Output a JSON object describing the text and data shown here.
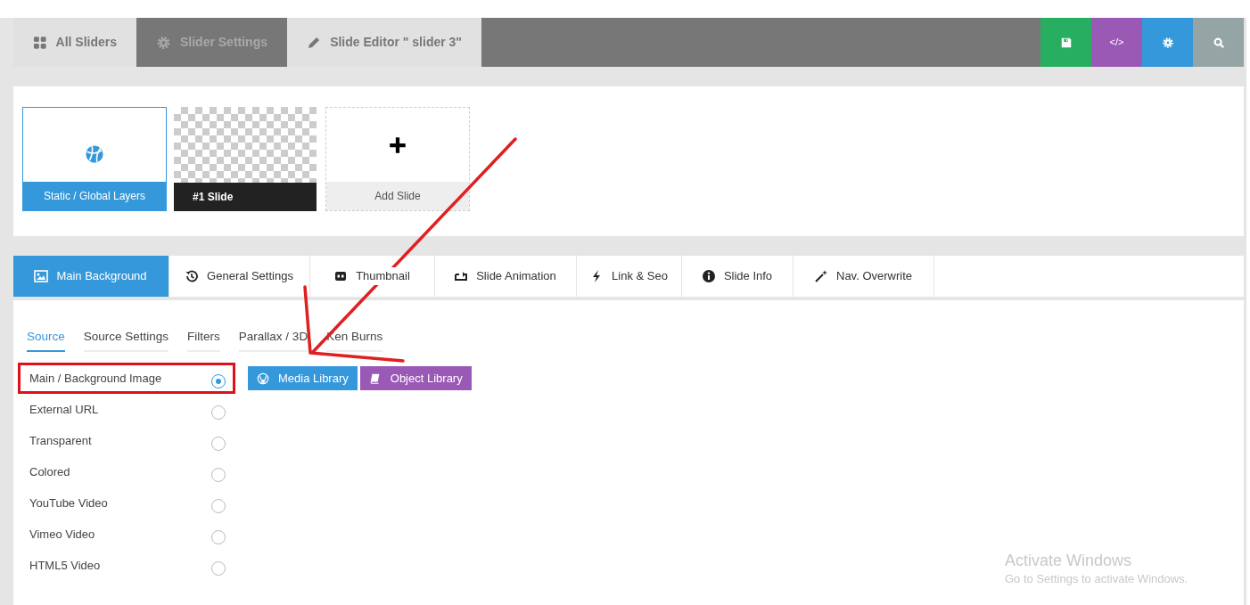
{
  "top_nav": {
    "tabs": [
      {
        "label": "All Sliders",
        "kind": "grid",
        "highlighted": true
      },
      {
        "label": "Slider Settings",
        "kind": "gear",
        "highlighted": false
      },
      {
        "label": "Slide Editor \" slider 3\"",
        "kind": "pencil",
        "highlighted": true
      }
    ],
    "tools": [
      {
        "kind": "save",
        "color": "#27ae60"
      },
      {
        "kind": "code",
        "label": "</>",
        "color": "#9b59b6"
      },
      {
        "kind": "settings",
        "color": "#3498db"
      },
      {
        "kind": "search",
        "color": "#95a5a6"
      }
    ]
  },
  "slides": [
    {
      "kind": "global",
      "label": "Static / Global Layers"
    },
    {
      "kind": "slide",
      "label": "#1 Slide"
    },
    {
      "kind": "add",
      "label": "Add Slide"
    }
  ],
  "editor_tabs": [
    {
      "label": "Main Background",
      "selected": true
    },
    {
      "label": "General Settings",
      "selected": false
    },
    {
      "label": "Thumbnail",
      "selected": false
    },
    {
      "label": "Slide Animation",
      "selected": false
    },
    {
      "label": "Link & Seo",
      "selected": false
    },
    {
      "label": "Slide Info",
      "selected": false
    },
    {
      "label": "Nav. Overwrite",
      "selected": false
    }
  ],
  "sub_tabs": [
    {
      "label": "Source",
      "selected": true
    },
    {
      "label": "Source Settings",
      "selected": false
    },
    {
      "label": "Filters",
      "selected": false
    },
    {
      "label": "Parallax / 3D",
      "selected": false
    },
    {
      "label": "Ken Burns",
      "selected": false
    }
  ],
  "source_options": [
    {
      "label": "Main / Background Image",
      "selected": true,
      "highlighted": true
    },
    {
      "label": "External URL",
      "selected": false,
      "highlighted": false
    },
    {
      "label": "Transparent",
      "selected": false,
      "highlighted": false
    },
    {
      "label": "Colored",
      "selected": false,
      "highlighted": false
    },
    {
      "label": "YouTube Video",
      "selected": false,
      "highlighted": false
    },
    {
      "label": "Vimeo Video",
      "selected": false,
      "highlighted": false
    },
    {
      "label": "HTML5 Video",
      "selected": false,
      "highlighted": false
    }
  ],
  "library_buttons": [
    {
      "label": "Media Library",
      "color": "#3498db"
    },
    {
      "label": "Object Library",
      "color": "#9b59b6"
    }
  ],
  "activation_notice": {
    "title": "Activate Windows",
    "text": "Go to Settings to activate Windows."
  }
}
